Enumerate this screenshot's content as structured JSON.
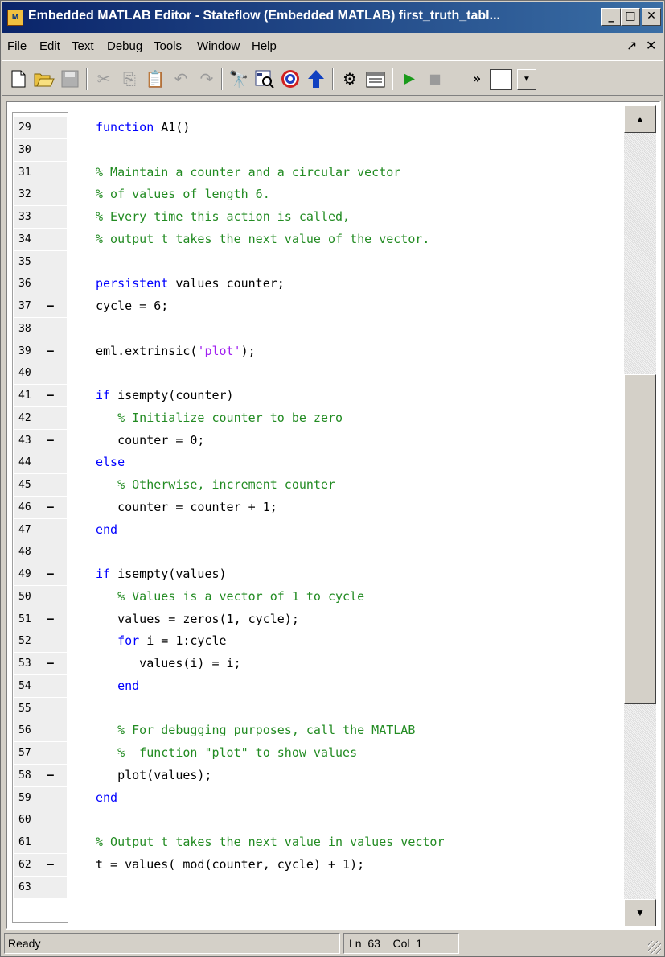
{
  "window": {
    "title": "Embedded MATLAB Editor - Stateflow (Embedded MATLAB) first_truth_tabl...",
    "app_icon_label": "M"
  },
  "menu": {
    "items": [
      "File",
      "Edit",
      "Text",
      "Debug",
      "Tools",
      "Window",
      "Help"
    ]
  },
  "toolbar": {
    "buttons": [
      "new-file",
      "open-file",
      "save",
      "cut",
      "copy",
      "paste",
      "undo",
      "redo",
      "find",
      "model-explorer",
      "target",
      "go-up",
      "build",
      "data-ports",
      "run",
      "stop"
    ]
  },
  "editor": {
    "lines": [
      {
        "num": "29",
        "dash": "",
        "segments": [
          {
            "t": "function ",
            "c": "kw"
          },
          {
            "t": "A1()",
            "c": ""
          }
        ]
      },
      {
        "num": "30",
        "dash": "",
        "segments": []
      },
      {
        "num": "31",
        "dash": "",
        "segments": [
          {
            "t": "% Maintain a counter and a circular vector",
            "c": "cm"
          }
        ]
      },
      {
        "num": "32",
        "dash": "",
        "segments": [
          {
            "t": "% of values of length 6.",
            "c": "cm"
          }
        ]
      },
      {
        "num": "33",
        "dash": "",
        "segments": [
          {
            "t": "% Every time this action is called,",
            "c": "cm"
          }
        ]
      },
      {
        "num": "34",
        "dash": "",
        "segments": [
          {
            "t": "% output t takes the next value of the vector.",
            "c": "cm"
          }
        ]
      },
      {
        "num": "35",
        "dash": "",
        "segments": []
      },
      {
        "num": "36",
        "dash": "",
        "segments": [
          {
            "t": "persistent ",
            "c": "kw"
          },
          {
            "t": "values counter;",
            "c": ""
          }
        ]
      },
      {
        "num": "37",
        "dash": "–",
        "segments": [
          {
            "t": "cycle = 6;",
            "c": ""
          }
        ]
      },
      {
        "num": "38",
        "dash": "",
        "segments": []
      },
      {
        "num": "39",
        "dash": "–",
        "segments": [
          {
            "t": "eml.extrinsic(",
            "c": ""
          },
          {
            "t": "'plot'",
            "c": "st"
          },
          {
            "t": ");",
            "c": ""
          }
        ]
      },
      {
        "num": "40",
        "dash": "",
        "segments": []
      },
      {
        "num": "41",
        "dash": "–",
        "segments": [
          {
            "t": "if ",
            "c": "kw"
          },
          {
            "t": "isempty(counter)",
            "c": ""
          }
        ]
      },
      {
        "num": "42",
        "dash": "",
        "segments": [
          {
            "t": "   % Initialize counter to be zero",
            "c": "cm"
          }
        ]
      },
      {
        "num": "43",
        "dash": "–",
        "segments": [
          {
            "t": "   counter = 0;",
            "c": ""
          }
        ]
      },
      {
        "num": "44",
        "dash": "",
        "segments": [
          {
            "t": "else",
            "c": "kw"
          }
        ]
      },
      {
        "num": "45",
        "dash": "",
        "segments": [
          {
            "t": "   % Otherwise, increment counter",
            "c": "cm"
          }
        ]
      },
      {
        "num": "46",
        "dash": "–",
        "segments": [
          {
            "t": "   counter = counter + 1;",
            "c": ""
          }
        ]
      },
      {
        "num": "47",
        "dash": "",
        "segments": [
          {
            "t": "end",
            "c": "kw"
          }
        ]
      },
      {
        "num": "48",
        "dash": "",
        "segments": []
      },
      {
        "num": "49",
        "dash": "–",
        "segments": [
          {
            "t": "if ",
            "c": "kw"
          },
          {
            "t": "isempty(values)",
            "c": ""
          }
        ]
      },
      {
        "num": "50",
        "dash": "",
        "segments": [
          {
            "t": "   % Values is a vector of 1 to cycle",
            "c": "cm"
          }
        ]
      },
      {
        "num": "51",
        "dash": "–",
        "segments": [
          {
            "t": "   values = zeros(1, cycle);",
            "c": ""
          }
        ]
      },
      {
        "num": "52",
        "dash": "",
        "segments": [
          {
            "t": "   ",
            "c": ""
          },
          {
            "t": "for ",
            "c": "kw"
          },
          {
            "t": "i = 1:cycle",
            "c": ""
          }
        ]
      },
      {
        "num": "53",
        "dash": "–",
        "segments": [
          {
            "t": "      values(i) = i;",
            "c": ""
          }
        ]
      },
      {
        "num": "54",
        "dash": "",
        "segments": [
          {
            "t": "   ",
            "c": ""
          },
          {
            "t": "end",
            "c": "kw"
          }
        ]
      },
      {
        "num": "55",
        "dash": "",
        "segments": []
      },
      {
        "num": "56",
        "dash": "",
        "segments": [
          {
            "t": "   % For debugging purposes, call the MATLAB",
            "c": "cm"
          }
        ]
      },
      {
        "num": "57",
        "dash": "",
        "segments": [
          {
            "t": "   %  function \"plot\" to show values",
            "c": "cm"
          }
        ]
      },
      {
        "num": "58",
        "dash": "–",
        "segments": [
          {
            "t": "   plot(values);",
            "c": ""
          }
        ]
      },
      {
        "num": "59",
        "dash": "",
        "segments": [
          {
            "t": "end",
            "c": "kw"
          }
        ]
      },
      {
        "num": "60",
        "dash": "",
        "segments": []
      },
      {
        "num": "61",
        "dash": "",
        "segments": [
          {
            "t": "% Output t takes the next value in values vector",
            "c": "cm"
          }
        ]
      },
      {
        "num": "62",
        "dash": "–",
        "segments": [
          {
            "t": "t = values( mod(counter, cycle) + 1);",
            "c": ""
          }
        ]
      },
      {
        "num": "63",
        "dash": "",
        "segments": []
      }
    ]
  },
  "status": {
    "ready": "Ready",
    "position": "Ln  63    Col  1"
  },
  "colors": {
    "keyword": "#0000ff",
    "comment": "#228b22",
    "string": "#a020f0",
    "title_bar": "#0a246a"
  }
}
